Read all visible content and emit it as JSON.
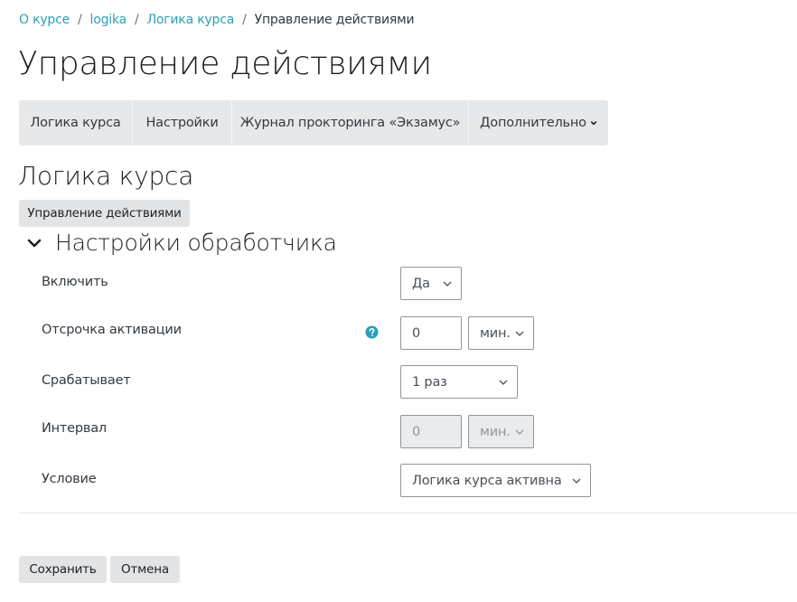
{
  "breadcrumb": {
    "items": [
      "О курсе",
      "logika",
      "Логика курса"
    ],
    "current": "Управление действиями",
    "separator": "/"
  },
  "page_title": "Управление действиями",
  "secondary_nav": {
    "items": [
      "Логика курса",
      "Настройки",
      "Журнал прокторинга «Экзамус»",
      "Дополнительно"
    ]
  },
  "section_title": "Логика курса",
  "manage_actions_button": "Управление действиями",
  "fieldset": {
    "legend": "Настройки обработчика",
    "fields": {
      "enable": {
        "label": "Включить",
        "value": "Да"
      },
      "activation_delay": {
        "label": "Отсрочка активации",
        "value": "0",
        "unit": "мин."
      },
      "fires": {
        "label": "Срабатывает",
        "value": "1 раз"
      },
      "interval": {
        "label": "Интервал",
        "value": "0",
        "unit": "мин."
      },
      "condition": {
        "label": "Условие",
        "value": "Логика курса активна"
      }
    }
  },
  "actions": {
    "save": "Сохранить",
    "cancel": "Отмена"
  },
  "icons": {
    "help": "question-circle-icon",
    "chevron": "chevron-down-icon",
    "caret": "caret-down-icon"
  },
  "colors": {
    "link": "#2b9fb8",
    "nav_bg": "#e7e8e9",
    "button_bg": "#e3e4e5",
    "help_icon": "#2b9fb8",
    "disabled_bg": "#e9ecef"
  }
}
